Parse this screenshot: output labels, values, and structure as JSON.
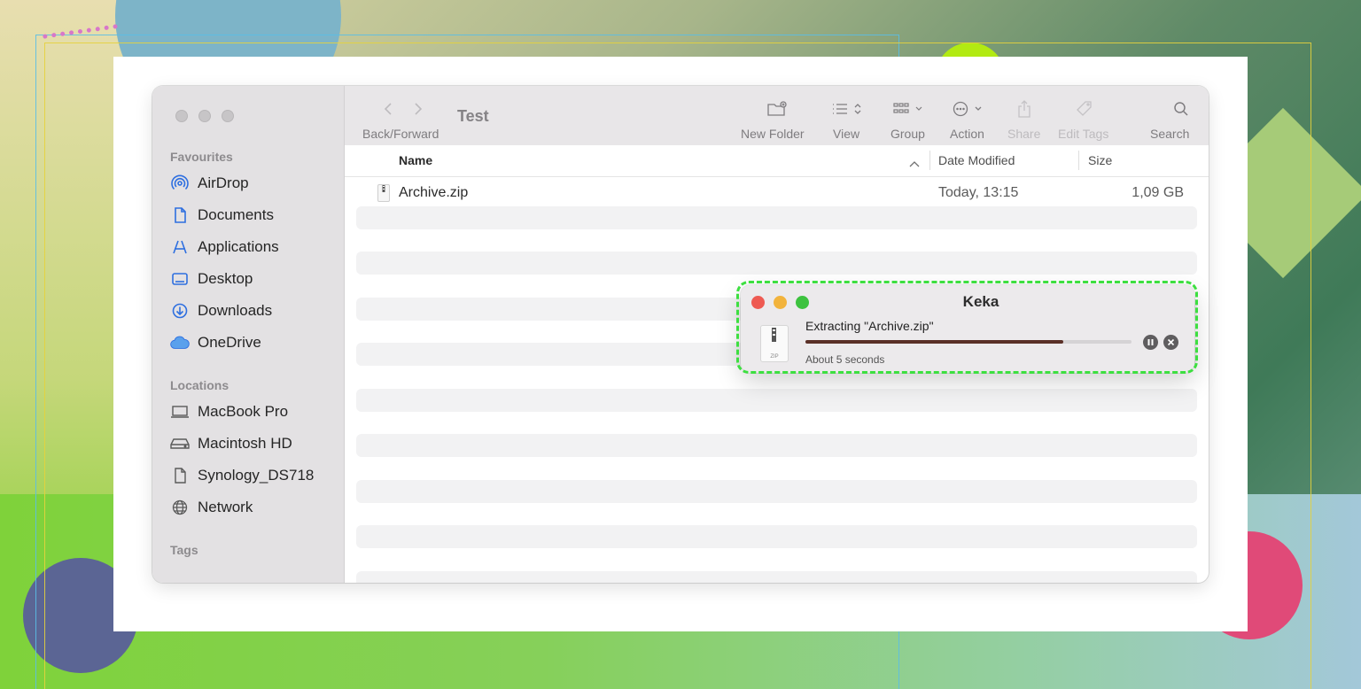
{
  "finder": {
    "title": "Test",
    "sidebar": {
      "favourites_heading": "Favourites",
      "favourites": [
        {
          "label": "AirDrop",
          "icon": "airdrop-icon"
        },
        {
          "label": "Documents",
          "icon": "document-icon"
        },
        {
          "label": "Applications",
          "icon": "applications-icon"
        },
        {
          "label": "Desktop",
          "icon": "desktop-icon"
        },
        {
          "label": "Downloads",
          "icon": "download-icon"
        },
        {
          "label": "OneDrive",
          "icon": "cloud-icon"
        }
      ],
      "locations_heading": "Locations",
      "locations": [
        {
          "label": "MacBook Pro",
          "icon": "laptop-icon"
        },
        {
          "label": "Macintosh HD",
          "icon": "drive-icon"
        },
        {
          "label": "Synology_DS718",
          "icon": "document-icon"
        },
        {
          "label": "Network",
          "icon": "globe-icon"
        }
      ],
      "tags_heading": "Tags"
    },
    "toolbar": {
      "back_forward": "Back/Forward",
      "new_folder": "New Folder",
      "view": "View",
      "group": "Group",
      "action": "Action",
      "share": "Share",
      "edit_tags": "Edit Tags",
      "search": "Search"
    },
    "columns": {
      "name": "Name",
      "date_modified": "Date Modified",
      "size": "Size"
    },
    "files": [
      {
        "name": "Archive.zip",
        "date_modified": "Today, 13:15",
        "size": "1,09 GB"
      }
    ],
    "accent_color": "#2e6fe0"
  },
  "keka": {
    "title": "Keka",
    "status": "Extracting \"Archive.zip\"",
    "eta": "About 5 seconds",
    "progress": 0.79,
    "file_icon_label": "ZIP",
    "highlight_color": "#3ddf40"
  }
}
